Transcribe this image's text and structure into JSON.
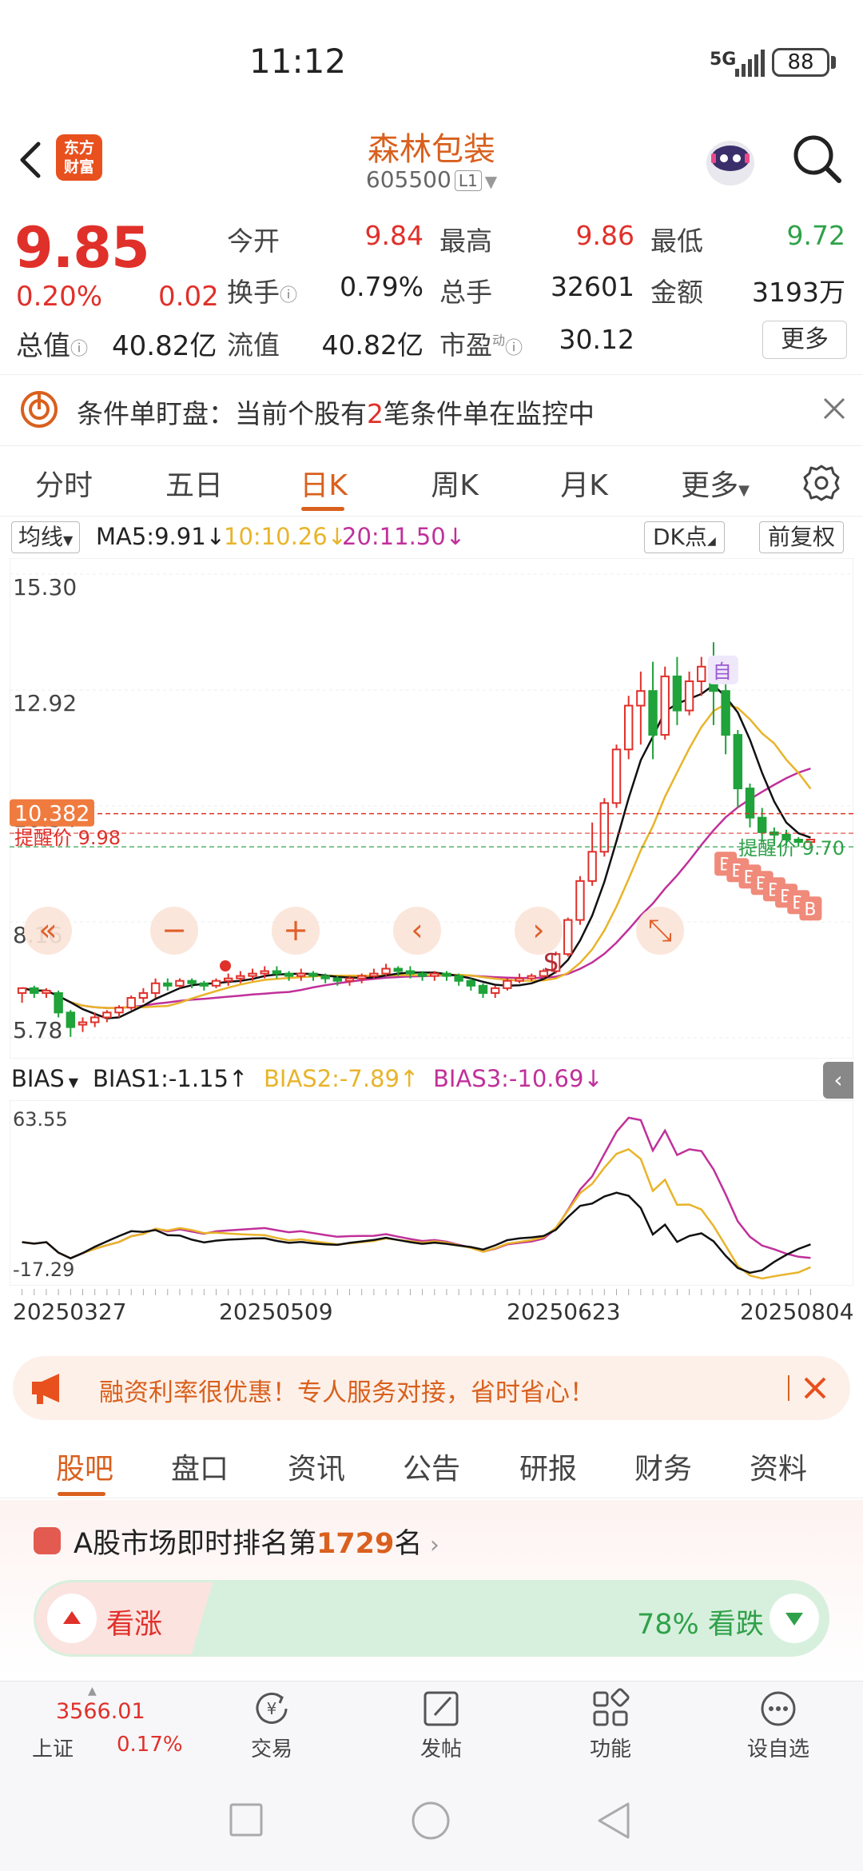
{
  "status": {
    "time": "11:12",
    "network": "5G",
    "battery": "88"
  },
  "header": {
    "logo": "东方\n财富",
    "stock_name": "森林包装",
    "stock_code": "605500",
    "level": "L1"
  },
  "quote": {
    "price": "9.85",
    "change_pct": "0.20%",
    "change": "0.02",
    "market_cap_label": "总值",
    "market_cap": "40.82亿",
    "rows": [
      [
        {
          "label": "今开",
          "value": "9.84",
          "color": "#e0302a"
        },
        {
          "label": "最高",
          "value": "9.86",
          "color": "#e0302a"
        },
        {
          "label": "最低",
          "value": "9.72",
          "color": "#2fa14a"
        }
      ],
      [
        {
          "label": "换手",
          "value": "0.79%",
          "color": "#222222"
        },
        {
          "label": "总手",
          "value": "32601",
          "color": "#222222"
        },
        {
          "label": "金额",
          "value": "3193万",
          "color": "#222222"
        }
      ],
      [
        {
          "label": "流值",
          "value": "40.82亿",
          "color": "#222222"
        },
        {
          "label": "市盈",
          "value": "30.12",
          "color": "#222222"
        }
      ]
    ],
    "pe_sup": "动",
    "more": "更多"
  },
  "alert": {
    "prefix": "条件单盯盘：当前个股有",
    "count": "2",
    "suffix": "笔条件单在监控中"
  },
  "tabs": [
    "分时",
    "五日",
    "日K",
    "周K",
    "月K",
    "更多"
  ],
  "active_tab": 2,
  "ma": {
    "select": "均线",
    "ma5": "MA5:9.91↓",
    "ma10": "10:10.26↓",
    "ma20": "20:11.50↓",
    "dk": "DK点",
    "adjust": "前复权"
  },
  "colors": {
    "up": "#e0302a",
    "down": "#1fa33a",
    "ma5": "#111111",
    "ma10": "#e8b42a",
    "ma20": "#c0309a",
    "accent": "#d9601e"
  },
  "chart_data": [
    {
      "type": "candlestick",
      "y_ticks": [
        "15.30",
        "12.92",
        "10.54",
        "8.16",
        "5.78"
      ],
      "ylim": [
        5.78,
        15.3
      ],
      "current_price_label": "10.382",
      "current_price": 10.382,
      "alert_price_label": "提醒价 9.98",
      "alert_price": 9.98,
      "alert_price2_label": "提醒价 9.70",
      "alert_price2": 9.7,
      "annotation": "自",
      "buy_marker": "B",
      "sell_marker": "S",
      "candles": [
        [
          6.7,
          6.8,
          6.5,
          6.75
        ],
        [
          6.8,
          6.7,
          6.6,
          6.85
        ],
        [
          6.7,
          6.75,
          6.6,
          6.8
        ],
        [
          6.7,
          6.3,
          6.2,
          6.75
        ],
        [
          6.3,
          6.0,
          5.8,
          6.35
        ],
        [
          6.05,
          6.1,
          5.9,
          6.2
        ],
        [
          6.1,
          6.2,
          6.0,
          6.3
        ],
        [
          6.2,
          6.3,
          6.1,
          6.35
        ],
        [
          6.3,
          6.4,
          6.2,
          6.45
        ],
        [
          6.4,
          6.6,
          6.35,
          6.65
        ],
        [
          6.6,
          6.7,
          6.5,
          6.8
        ],
        [
          6.7,
          6.9,
          6.6,
          7.0
        ],
        [
          6.9,
          6.85,
          6.75,
          7.0
        ],
        [
          6.85,
          6.95,
          6.8,
          7.0
        ],
        [
          6.95,
          6.9,
          6.8,
          7.0
        ],
        [
          6.9,
          6.85,
          6.75,
          6.95
        ],
        [
          6.85,
          6.95,
          6.8,
          7.0
        ],
        [
          6.95,
          7.0,
          6.85,
          7.1
        ],
        [
          7.0,
          7.05,
          6.9,
          7.15
        ],
        [
          7.05,
          7.1,
          6.95,
          7.2
        ],
        [
          7.1,
          7.15,
          7.0,
          7.25
        ],
        [
          7.15,
          7.1,
          7.0,
          7.25
        ],
        [
          7.1,
          7.05,
          6.95,
          7.15
        ],
        [
          7.05,
          7.1,
          6.95,
          7.2
        ],
        [
          7.1,
          7.05,
          6.95,
          7.15
        ],
        [
          7.05,
          7.0,
          6.9,
          7.1
        ],
        [
          7.0,
          6.95,
          6.85,
          7.05
        ],
        [
          6.95,
          7.0,
          6.85,
          7.05
        ],
        [
          7.0,
          7.05,
          6.9,
          7.1
        ],
        [
          7.05,
          7.1,
          7.0,
          7.2
        ],
        [
          7.1,
          7.2,
          7.05,
          7.3
        ],
        [
          7.2,
          7.15,
          7.05,
          7.25
        ],
        [
          7.15,
          7.1,
          7.0,
          7.25
        ],
        [
          7.1,
          7.05,
          6.95,
          7.15
        ],
        [
          7.05,
          7.1,
          6.95,
          7.15
        ],
        [
          7.1,
          7.05,
          6.95,
          7.15
        ],
        [
          7.05,
          6.95,
          6.85,
          7.1
        ],
        [
          6.95,
          6.85,
          6.75,
          7.0
        ],
        [
          6.85,
          6.7,
          6.6,
          6.9
        ],
        [
          6.7,
          6.8,
          6.6,
          6.85
        ],
        [
          6.8,
          6.95,
          6.75,
          7.0
        ],
        [
          6.95,
          7.0,
          6.9,
          7.1
        ],
        [
          7.0,
          7.05,
          6.95,
          7.1
        ],
        [
          7.05,
          7.15,
          7.0,
          7.2
        ],
        [
          7.15,
          7.5,
          7.1,
          7.55
        ],
        [
          7.5,
          8.2,
          7.45,
          8.25
        ],
        [
          8.2,
          9.0,
          8.1,
          9.1
        ],
        [
          9.0,
          9.6,
          8.9,
          10.2
        ],
        [
          9.6,
          10.6,
          9.5,
          10.7
        ],
        [
          10.6,
          11.7,
          10.5,
          11.8
        ],
        [
          11.7,
          12.6,
          11.5,
          12.8
        ],
        [
          12.6,
          12.9,
          11.8,
          13.3
        ],
        [
          12.9,
          12.0,
          11.5,
          13.5
        ],
        [
          12.0,
          13.2,
          11.9,
          13.4
        ],
        [
          13.2,
          12.5,
          12.2,
          13.6
        ],
        [
          12.5,
          13.1,
          12.4,
          13.3
        ],
        [
          13.1,
          13.4,
          12.8,
          13.6
        ],
        [
          13.4,
          12.9,
          12.2,
          13.9
        ],
        [
          12.9,
          12.0,
          11.6,
          13.1
        ],
        [
          12.0,
          10.9,
          10.5,
          12.1
        ],
        [
          10.9,
          10.3,
          10.1,
          11.0
        ],
        [
          10.3,
          10.0,
          9.8,
          10.5
        ],
        [
          10.0,
          9.95,
          9.75,
          10.1
        ],
        [
          9.95,
          9.85,
          9.72,
          10.05
        ],
        [
          9.85,
          9.8,
          9.7,
          9.9
        ],
        [
          9.8,
          9.85,
          9.72,
          9.86
        ]
      ]
    },
    {
      "type": "line",
      "name": "BIAS",
      "y_ticks": [
        "63.55",
        "-17.29"
      ],
      "ylim": [
        -17.29,
        63.55
      ],
      "series_labels": [
        "BIAS1:-1.15↑",
        "BIAS2:-7.89↑",
        "BIAS3:-10.69↓"
      ],
      "x_ticks": [
        "20250327",
        "20250509",
        "20250623",
        "20250804"
      ]
    }
  ],
  "bias_select": "BIAS",
  "promo": {
    "text": "融资利率很优惠！专人服务对接，省时省心！"
  },
  "bottom_tabs": [
    "股吧",
    "盘口",
    "资讯",
    "公告",
    "研报",
    "财务",
    "资料"
  ],
  "ranking": {
    "prefix": "A股市场即时排名第",
    "rank": "1729",
    "suffix": "名"
  },
  "sentiment": {
    "bull": "看涨",
    "bear": "78% 看跌",
    "bear_pct": 0.78
  },
  "navbar": {
    "index_value": "3566.01",
    "index_name": "上证",
    "index_pct": "0.17%",
    "items": [
      "交易",
      "发帖",
      "功能",
      "设自选"
    ]
  }
}
